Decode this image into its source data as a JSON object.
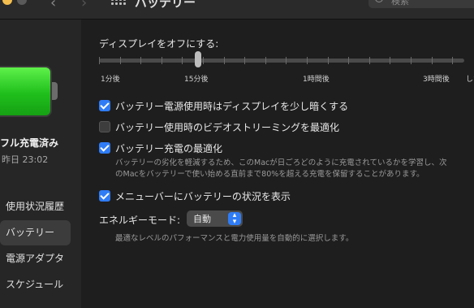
{
  "toolbar": {
    "title": "バッテリー",
    "search_placeholder": "検索",
    "back_glyph": "‹",
    "forward_glyph": "›"
  },
  "sidebar": {
    "battery_status": "フル充電済み",
    "battery_time": "昨日 23:02",
    "items": [
      {
        "label": "使用状況履歴",
        "selected": false
      },
      {
        "label": "バッテリー",
        "selected": true
      },
      {
        "label": "電源アダプタ",
        "selected": false
      },
      {
        "label": "スケジュール",
        "selected": false
      }
    ]
  },
  "main": {
    "display_off_label": "ディスプレイをオフにする:",
    "slider_labels": [
      "1分後",
      "15分後",
      "1時間後",
      "3時間後",
      "しない"
    ],
    "options": [
      {
        "label": "バッテリー電源使用時はディスプレイを少し暗くする",
        "checked": true
      },
      {
        "label": "バッテリー使用時のビデオストリーミングを最適化",
        "checked": false
      },
      {
        "label": "バッテリー充電の最適化",
        "checked": true,
        "description_line1": "バッテリーの劣化を軽減するため、このMacが日ごろどのように充電されているかを学習し、次",
        "description_line2": "のMacをバッテリーで使い始める直前まで80%を超える充電を保留することがあります。"
      },
      {
        "label": "メニューバーにバッテリーの状況を表示",
        "checked": true
      }
    ],
    "energy_mode_label": "エネルギーモード:",
    "energy_mode_value": "自動",
    "energy_mode_description": "最適なレベルのパフォーマンスと電力使用量を自動的に選択します。"
  },
  "colors": {
    "accent": "#2f7cf6",
    "battery_green": "#1fbf1c"
  }
}
